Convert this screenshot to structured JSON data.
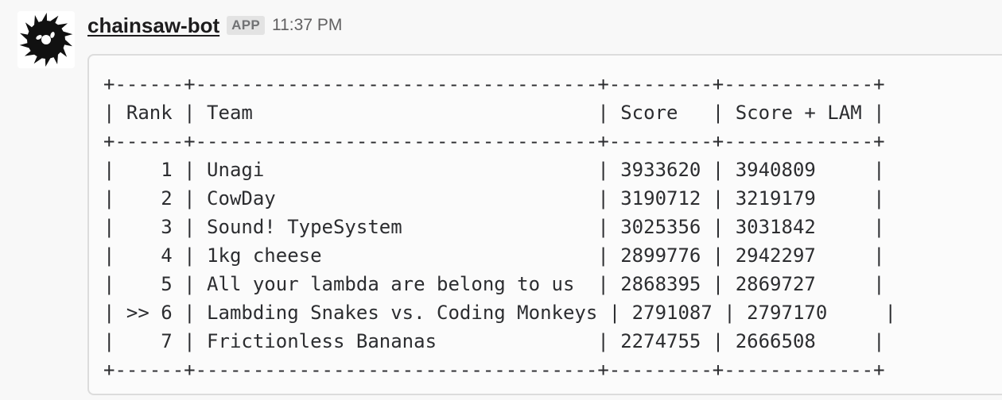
{
  "message": {
    "username": "chainsaw-bot",
    "badge": "APP",
    "timestamp": "11:37 PM",
    "code_lines": [
      "+------+-----------------------------------+---------+-------------+",
      "| Rank | Team                              | Score   | Score + LAM |",
      "+------+-----------------------------------+---------+-------------+",
      "|    1 | Unagi                             | 3933620 | 3940809     |",
      "|    2 | CowDay                            | 3190712 | 3219179     |",
      "|    3 | Sound! TypeSystem                 | 3025356 | 3031842     |",
      "|    4 | 1kg cheese                        | 2899776 | 2942297     |",
      "|    5 | All your lambda are belong to us  | 2868395 | 2869727     |",
      "| >> 6 | Lambding Snakes vs. Coding Monkeys | 2791087 | 2797170     |",
      "|    7 | Frictionless Bananas              | 2274755 | 2666508     |",
      "+------+-----------------------------------+---------+-------------+"
    ]
  },
  "colors": {
    "background": "#f8f8f8",
    "code_background": "#fbfbfb",
    "code_border": "#dcdcdc",
    "badge_background": "#e3e3e3",
    "badge_text": "#717274",
    "timestamp": "#616061",
    "text": "#2c2d30"
  },
  "icons": {
    "avatar": "saw-blade-icon"
  }
}
